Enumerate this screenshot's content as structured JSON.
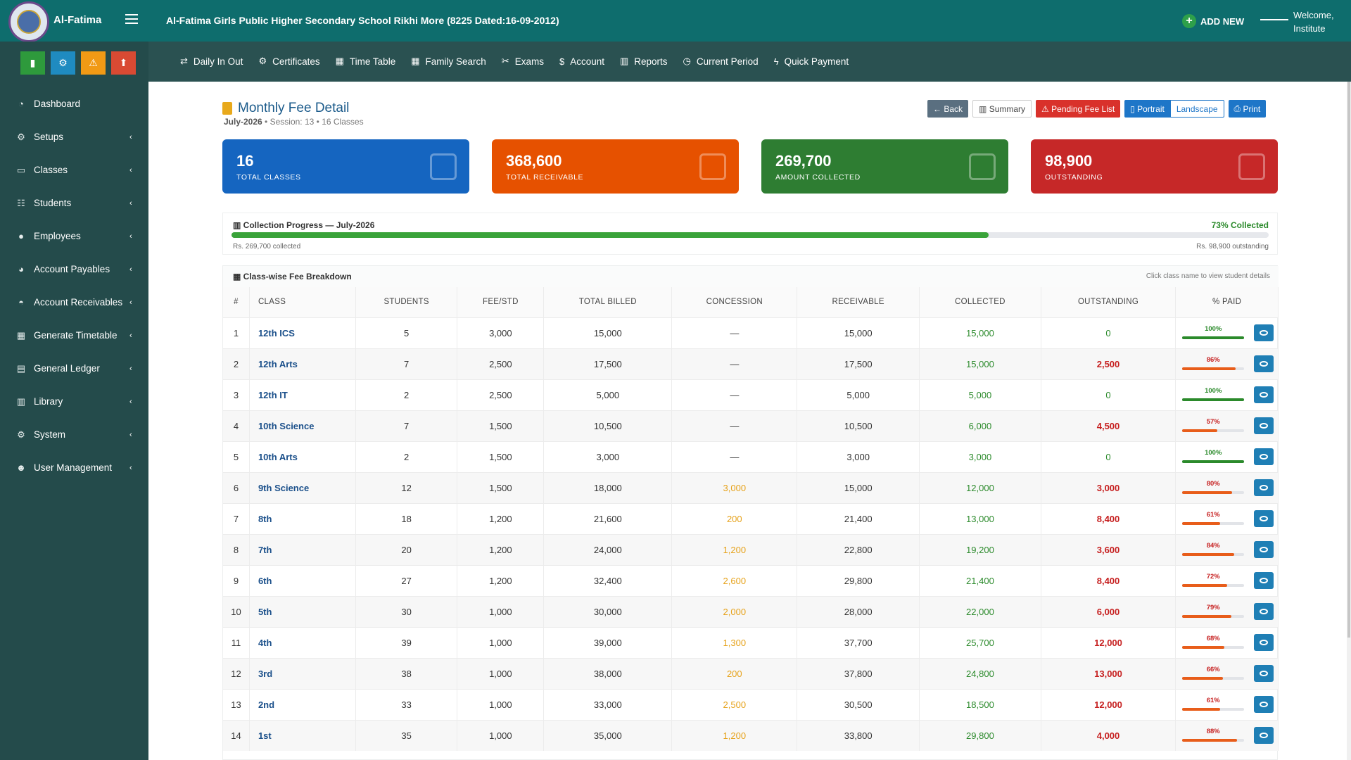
{
  "brand": {
    "name": "Al-Fatima"
  },
  "header": {
    "school_title": "Al-Fatima Girls Public Higher Secondary School Rikhi More (8225 Dated:16-09-2012)",
    "add_new": "ADD NEW",
    "welcome_line1": "Welcome,",
    "welcome_line2": "Institute"
  },
  "quick_buttons": [
    {
      "icon": "signal-icon",
      "color": "#2e9a3c"
    },
    {
      "icon": "gears-icon",
      "color": "#1f8bc0"
    },
    {
      "icon": "warning-icon",
      "color": "#f19a15"
    },
    {
      "icon": "upload-icon",
      "color": "#d94a33"
    }
  ],
  "sidebar": {
    "items": [
      {
        "label": "Dashboard",
        "icon": "dashboard-icon",
        "chev": ""
      },
      {
        "label": "Setups",
        "icon": "gears-icon",
        "chev": "‹"
      },
      {
        "label": "Classes",
        "icon": "laptop-icon",
        "chev": "‹"
      },
      {
        "label": "Students",
        "icon": "students-icon",
        "chev": "‹"
      },
      {
        "label": "Employees",
        "icon": "user-icon",
        "chev": "‹"
      },
      {
        "label": "Account Payables",
        "icon": "arrow-up-circle-icon",
        "chev": "‹"
      },
      {
        "label": "Account Receivables",
        "icon": "arrow-down-circle-icon",
        "chev": "‹"
      },
      {
        "label": "Generate Timetable",
        "icon": "calendar-icon",
        "chev": "‹"
      },
      {
        "label": "General Ledger",
        "icon": "book-icon",
        "chev": "‹"
      },
      {
        "label": "Library",
        "icon": "library-icon",
        "chev": "‹"
      },
      {
        "label": "System",
        "icon": "cog-icon",
        "chev": "‹"
      },
      {
        "label": "User Management",
        "icon": "users-icon",
        "chev": "‹"
      }
    ]
  },
  "menubar": {
    "items": [
      {
        "label": "Daily In Out",
        "icon": "exchange-icon",
        "glyph": "⇄"
      },
      {
        "label": "Certificates",
        "icon": "cog-icon",
        "glyph": "⚙"
      },
      {
        "label": "Time Table",
        "icon": "calendar-icon",
        "glyph": "▦"
      },
      {
        "label": "Family Search",
        "icon": "calendar-icon",
        "glyph": "▦"
      },
      {
        "label": "Exams",
        "icon": "tools-icon",
        "glyph": "✂"
      },
      {
        "label": "Account",
        "icon": "dollar-icon",
        "glyph": "$"
      },
      {
        "label": "Reports",
        "icon": "chart-icon",
        "glyph": "▥"
      },
      {
        "label": "Current Period",
        "icon": "clock-icon",
        "glyph": "◷"
      },
      {
        "label": "Quick Payment",
        "icon": "bolt-icon",
        "glyph": "ϟ"
      }
    ]
  },
  "page": {
    "title": "Monthly Fee Detail",
    "month": "July-2026",
    "session": "Session: 13",
    "classes": "16 Classes",
    "sep": "•"
  },
  "toolbar": {
    "back": "Back",
    "summary": "Summary",
    "pending": "Pending Fee List",
    "portrait": "Portrait",
    "landscape": "Landscape",
    "print": "Print"
  },
  "cards": [
    {
      "value": "16",
      "caption": "TOTAL CLASSES",
      "color": "#1565c0"
    },
    {
      "value": "368,600",
      "caption": "TOTAL RECEIVABLE",
      "color": "#e65100"
    },
    {
      "value": "269,700",
      "caption": "AMOUNT COLLECTED",
      "color": "#2e7d32"
    },
    {
      "value": "98,900",
      "caption": "OUTSTANDING",
      "color": "#c62828"
    }
  ],
  "progress": {
    "title": "Collection Progress — July-2026",
    "percent_label": "73% Collected",
    "percent": 73,
    "collected_label": "Rs. 269,700 collected",
    "outstanding_label": "Rs. 98,900 outstanding"
  },
  "table": {
    "title": "Class-wise Fee Breakdown",
    "hint": "Click class name to view student details",
    "headers": [
      "#",
      "CLASS",
      "STUDENTS",
      "FEE/STD",
      "TOTAL BILLED",
      "CONCESSION",
      "RECEIVABLE",
      "COLLECTED",
      "OUTSTANDING",
      "% PAID"
    ],
    "rows": [
      {
        "n": "1",
        "cls": "12th ICS",
        "students": "5",
        "fee": "3,000",
        "billed": "15,000",
        "conc": "—",
        "recv": "15,000",
        "coll": "15,000",
        "outs": "0",
        "pct": "100%",
        "paid": 100
      },
      {
        "n": "2",
        "cls": "12th Arts",
        "students": "7",
        "fee": "2,500",
        "billed": "17,500",
        "conc": "—",
        "recv": "17,500",
        "coll": "15,000",
        "outs": "2,500",
        "pct": "86%",
        "paid": 86
      },
      {
        "n": "3",
        "cls": "12th IT",
        "students": "2",
        "fee": "2,500",
        "billed": "5,000",
        "conc": "—",
        "recv": "5,000",
        "coll": "5,000",
        "outs": "0",
        "pct": "100%",
        "paid": 100
      },
      {
        "n": "4",
        "cls": "10th Science",
        "students": "7",
        "fee": "1,500",
        "billed": "10,500",
        "conc": "—",
        "recv": "10,500",
        "coll": "6,000",
        "outs": "4,500",
        "pct": "57%",
        "paid": 57
      },
      {
        "n": "5",
        "cls": "10th Arts",
        "students": "2",
        "fee": "1,500",
        "billed": "3,000",
        "conc": "—",
        "recv": "3,000",
        "coll": "3,000",
        "outs": "0",
        "pct": "100%",
        "paid": 100
      },
      {
        "n": "6",
        "cls": "9th Science",
        "students": "12",
        "fee": "1,500",
        "billed": "18,000",
        "conc": "3,000",
        "recv": "15,000",
        "coll": "12,000",
        "outs": "3,000",
        "pct": "80%",
        "paid": 80
      },
      {
        "n": "7",
        "cls": "8th",
        "students": "18",
        "fee": "1,200",
        "billed": "21,600",
        "conc": "200",
        "recv": "21,400",
        "coll": "13,000",
        "outs": "8,400",
        "pct": "61%",
        "paid": 61
      },
      {
        "n": "8",
        "cls": "7th",
        "students": "20",
        "fee": "1,200",
        "billed": "24,000",
        "conc": "1,200",
        "recv": "22,800",
        "coll": "19,200",
        "outs": "3,600",
        "pct": "84%",
        "paid": 84
      },
      {
        "n": "9",
        "cls": "6th",
        "students": "27",
        "fee": "1,200",
        "billed": "32,400",
        "conc": "2,600",
        "recv": "29,800",
        "coll": "21,400",
        "outs": "8,400",
        "pct": "72%",
        "paid": 72
      },
      {
        "n": "10",
        "cls": "5th",
        "students": "30",
        "fee": "1,000",
        "billed": "30,000",
        "conc": "2,000",
        "recv": "28,000",
        "coll": "22,000",
        "outs": "6,000",
        "pct": "79%",
        "paid": 79
      },
      {
        "n": "11",
        "cls": "4th",
        "students": "39",
        "fee": "1,000",
        "billed": "39,000",
        "conc": "1,300",
        "recv": "37,700",
        "coll": "25,700",
        "outs": "12,000",
        "pct": "68%",
        "paid": 68
      },
      {
        "n": "12",
        "cls": "3rd",
        "students": "38",
        "fee": "1,000",
        "billed": "38,000",
        "conc": "200",
        "recv": "37,800",
        "coll": "24,800",
        "outs": "13,000",
        "pct": "66%",
        "paid": 66
      },
      {
        "n": "13",
        "cls": "2nd",
        "students": "33",
        "fee": "1,000",
        "billed": "33,000",
        "conc": "2,500",
        "recv": "30,500",
        "coll": "18,500",
        "outs": "12,000",
        "pct": "61%",
        "paid": 61
      },
      {
        "n": "14",
        "cls": "1st",
        "students": "35",
        "fee": "1,000",
        "billed": "35,000",
        "conc": "1,200",
        "recv": "33,800",
        "coll": "29,800",
        "outs": "4,000",
        "pct": "88%",
        "paid": 88
      }
    ]
  }
}
